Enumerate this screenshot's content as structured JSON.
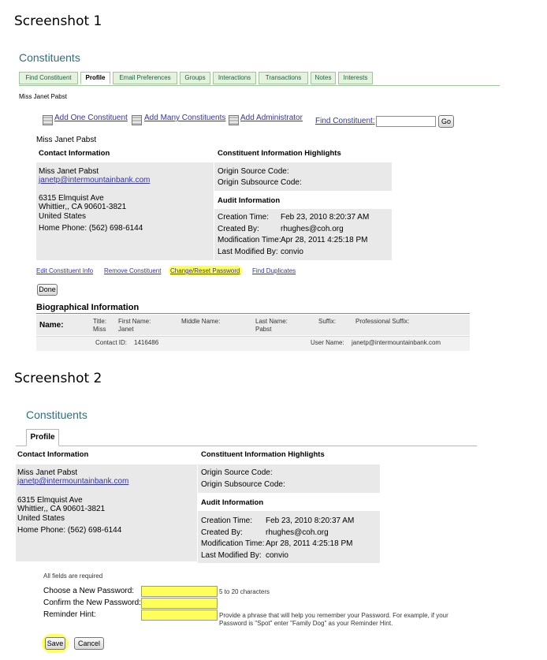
{
  "labels": {
    "screenshot1": "Screenshot 1",
    "screenshot2": "Screenshot 2"
  },
  "s1": {
    "page_title": "Constituents",
    "tabs": [
      "Find Constituent",
      "Profile",
      "Email Preferences",
      "Groups",
      "Interactions",
      "Transactions",
      "Notes",
      "Interests"
    ],
    "breadcrumb_name": "Miss Janet Pabst",
    "actions": {
      "add_one": "Add One Constituent",
      "add_many": "Add Many Constituents",
      "add_admin": "Add Administrator",
      "find_label": "Find Constituent",
      "find_value": "",
      "go": "Go"
    },
    "name_heading": "Miss Janet Pabst",
    "contact": {
      "header": "Contact Information",
      "name": "Miss Janet Pabst",
      "email": "janetp@intermountainbank.com",
      "street": "6315 Elmquist Ave",
      "city": "Whittier,, CA 90601-3821",
      "country": "United States",
      "phone": "Home Phone: (562) 698-6144"
    },
    "highlights": {
      "header": "Constituent Information Highlights",
      "origin_source": "Origin Source Code:",
      "origin_subsource": "Origin Subsource Code:"
    },
    "audit": {
      "header": "Audit Information",
      "creation_label": "Creation Time:",
      "creation_value": "Feb 23, 2010 8:20:37 AM",
      "created_by_label": "Created By:",
      "created_by_value": "rhughes@coh.org",
      "modification_label": "Modification Time:",
      "modification_value": "Apr 28, 2011 4:25:18 PM",
      "last_modified_label": "Last Modified By:",
      "last_modified_value": "convio"
    },
    "links": {
      "edit": "Edit Constituent Info",
      "remove": "Remove Constituent",
      "change_password": "Change/Reset Password",
      "find_duplicates": "Find Duplicates"
    },
    "done": "Done",
    "bio": {
      "header": "Biographical Information",
      "name_label": "Name:",
      "title_label": "Title:",
      "title_value": "Miss",
      "first_label": "First Name:",
      "first_value": "Janet",
      "middle_label": "Middle Name:",
      "last_label": "Last Name:",
      "last_value": "Pabst",
      "suffix_label": "Suffix:",
      "prof_suffix_label": "Professional Suffix:",
      "contact_id_label": "Contact ID:",
      "contact_id_value": "1416486",
      "user_name_label": "User Name:",
      "user_name_value": "janetp@intermountainbank.com"
    }
  },
  "s2": {
    "page_title": "Constituents",
    "tab": "Profile",
    "contact": {
      "header": "Contact Information",
      "name": "Miss Janet Pabst",
      "email": "janetp@intermountainbank.com",
      "street": "6315 Elmquist Ave",
      "city": "Whittier,, CA 90601-3821",
      "country": "United States",
      "phone": "Home Phone: (562) 698-6144"
    },
    "highlights": {
      "header": "Constituent Information Highlights",
      "origin_source": "Origin Source Code:",
      "origin_subsource": "Origin Subsource Code:"
    },
    "audit": {
      "header": "Audit Information",
      "creation_label": "Creation Time:",
      "creation_value": "Feb 23, 2010 8:20:37 AM",
      "created_by_label": "Created By:",
      "created_by_value": "rhughes@coh.org",
      "modification_label": "Modification Time:",
      "modification_value": "Apr 28, 2011 4:25:18 PM",
      "last_modified_label": "Last Modified By:",
      "last_modified_value": "convio"
    },
    "form": {
      "required_note": "All fields are required",
      "new_password_label": "Choose a New Password:",
      "new_password_value": "",
      "new_password_hint": "5 to 20 characters",
      "confirm_label": "Confirm the New Password:",
      "confirm_value": "",
      "reminder_label": "Reminder Hint:",
      "reminder_value": "",
      "reminder_help_line1": "Provide a phrase that will help you remember your Password. For example, if your",
      "reminder_help_line2": "Password is \"Spot\" enter \"Family Dog\" as your Reminder Hint.",
      "save": "Save",
      "cancel": "Cancel"
    }
  },
  "colors": {
    "page_title": "#2e6e7e",
    "tab_bg": "#e4f2de",
    "tab_border": "#9fc59a",
    "link": "#3333aa",
    "highlight": "#ffff5a",
    "panel_gray": "#e9e9e9"
  }
}
